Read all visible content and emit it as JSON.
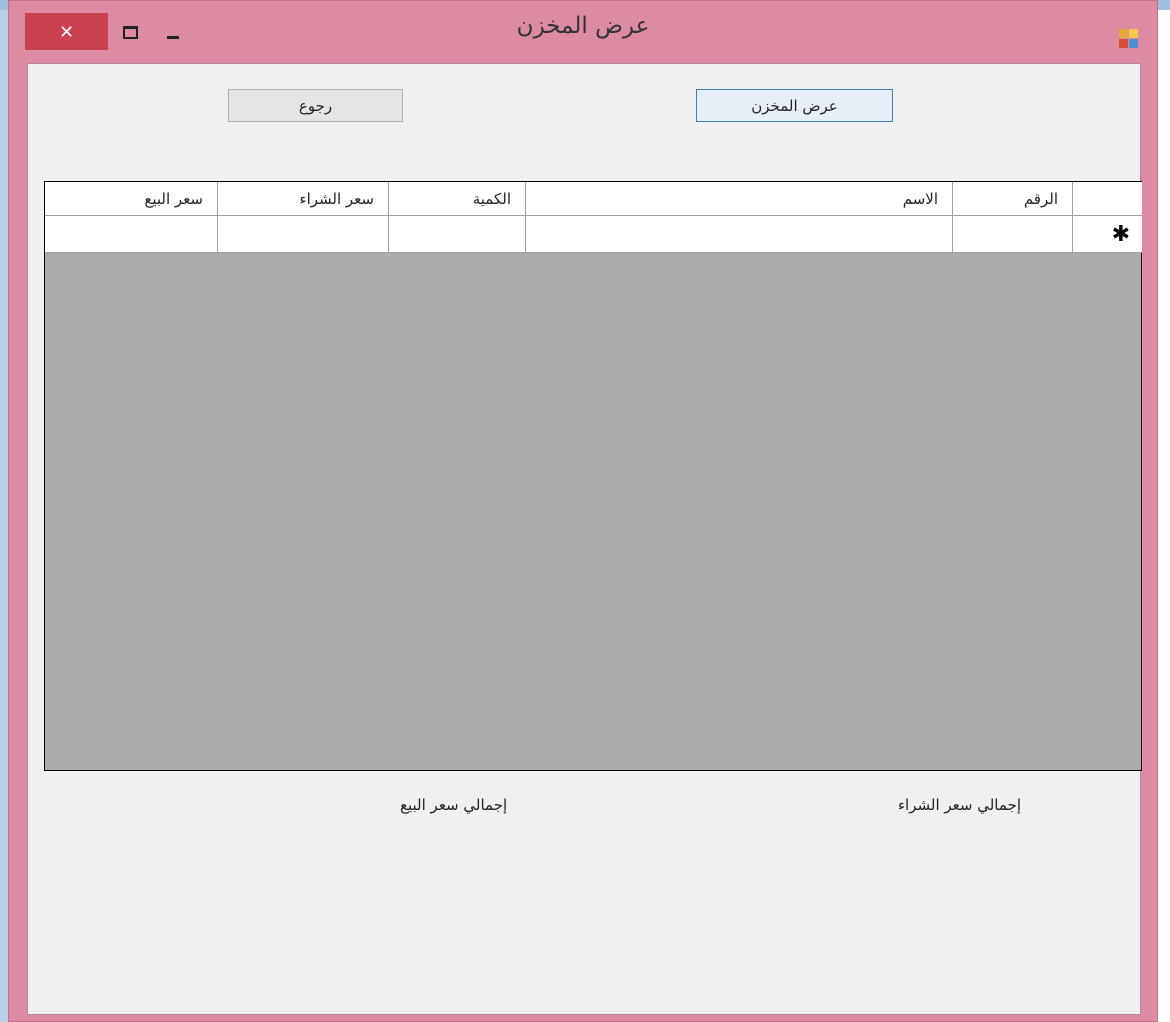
{
  "window": {
    "title": "عرض المخزن",
    "close_glyph": "✕",
    "background_color": "#dc8ba2",
    "close_color": "#c9404f"
  },
  "buttons": {
    "show_inventory": "عرض المخزن",
    "back": "رجوع"
  },
  "grid": {
    "columns": [
      "الرقم",
      "الاسم",
      "الكمية",
      "سعر الشراء",
      "سعر البيع"
    ],
    "new_row_marker": "✱",
    "rows": [
      [
        "",
        "",
        "",
        "",
        ""
      ]
    ]
  },
  "totals": {
    "purchase_label": "إجمالي سعر الشراء",
    "sale_label": "إجمالي سعر البيع"
  }
}
